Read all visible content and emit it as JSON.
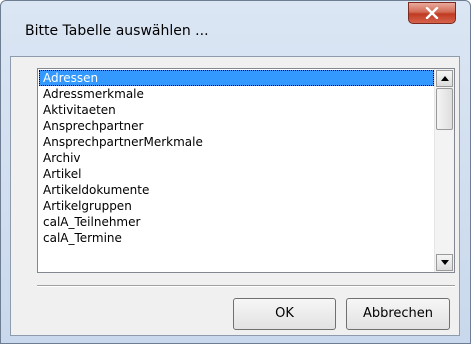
{
  "window": {
    "title": "Bitte Tabelle auswählen ..."
  },
  "list": {
    "items": [
      {
        "label": "Adressen",
        "selected": true
      },
      {
        "label": "Adressmerkmale"
      },
      {
        "label": "Aktivitaeten"
      },
      {
        "label": "Ansprechpartner"
      },
      {
        "label": "AnsprechpartnerMerkmale"
      },
      {
        "label": "Archiv"
      },
      {
        "label": "Artikel"
      },
      {
        "label": "Artikeldokumente"
      },
      {
        "label": "Artikelgruppen"
      },
      {
        "label": "calA_Teilnehmer"
      },
      {
        "label": "calA_Termine"
      }
    ]
  },
  "buttons": {
    "ok_label": "OK",
    "cancel_label": "Abbrechen"
  },
  "colors": {
    "selection": "#3399ff",
    "close_button": "#c13a22"
  }
}
